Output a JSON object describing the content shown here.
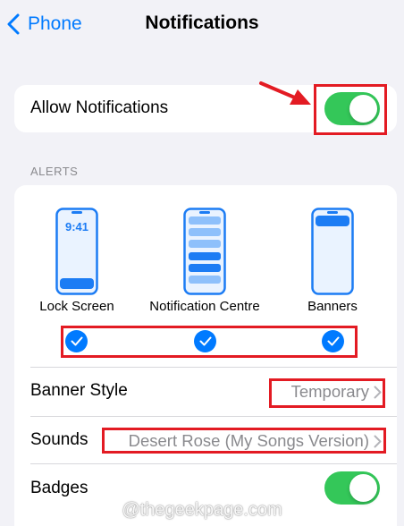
{
  "nav": {
    "back_label": "Phone",
    "title": "Notifications"
  },
  "allow": {
    "label": "Allow Notifications",
    "toggle_on": true
  },
  "alerts": {
    "header": "ALERTS",
    "styles": [
      {
        "label": "Lock Screen",
        "preview_time": "9:41",
        "checked": true,
        "icon": "lock-screen-preview-icon"
      },
      {
        "label": "Notification Centre",
        "checked": true,
        "icon": "notification-centre-preview-icon"
      },
      {
        "label": "Banners",
        "checked": true,
        "icon": "banners-preview-icon"
      }
    ]
  },
  "banner_style": {
    "label": "Banner Style",
    "value": "Temporary"
  },
  "sounds": {
    "label": "Sounds",
    "value": "Desert Rose (My Songs Version)"
  },
  "badges": {
    "label": "Badges",
    "toggle_on": true
  },
  "watermark": "@thegeekpage.com",
  "colors": {
    "accent": "#007aff",
    "toggle_on": "#34c759",
    "annotation": "#e31b23",
    "background": "#f2f2f7"
  }
}
